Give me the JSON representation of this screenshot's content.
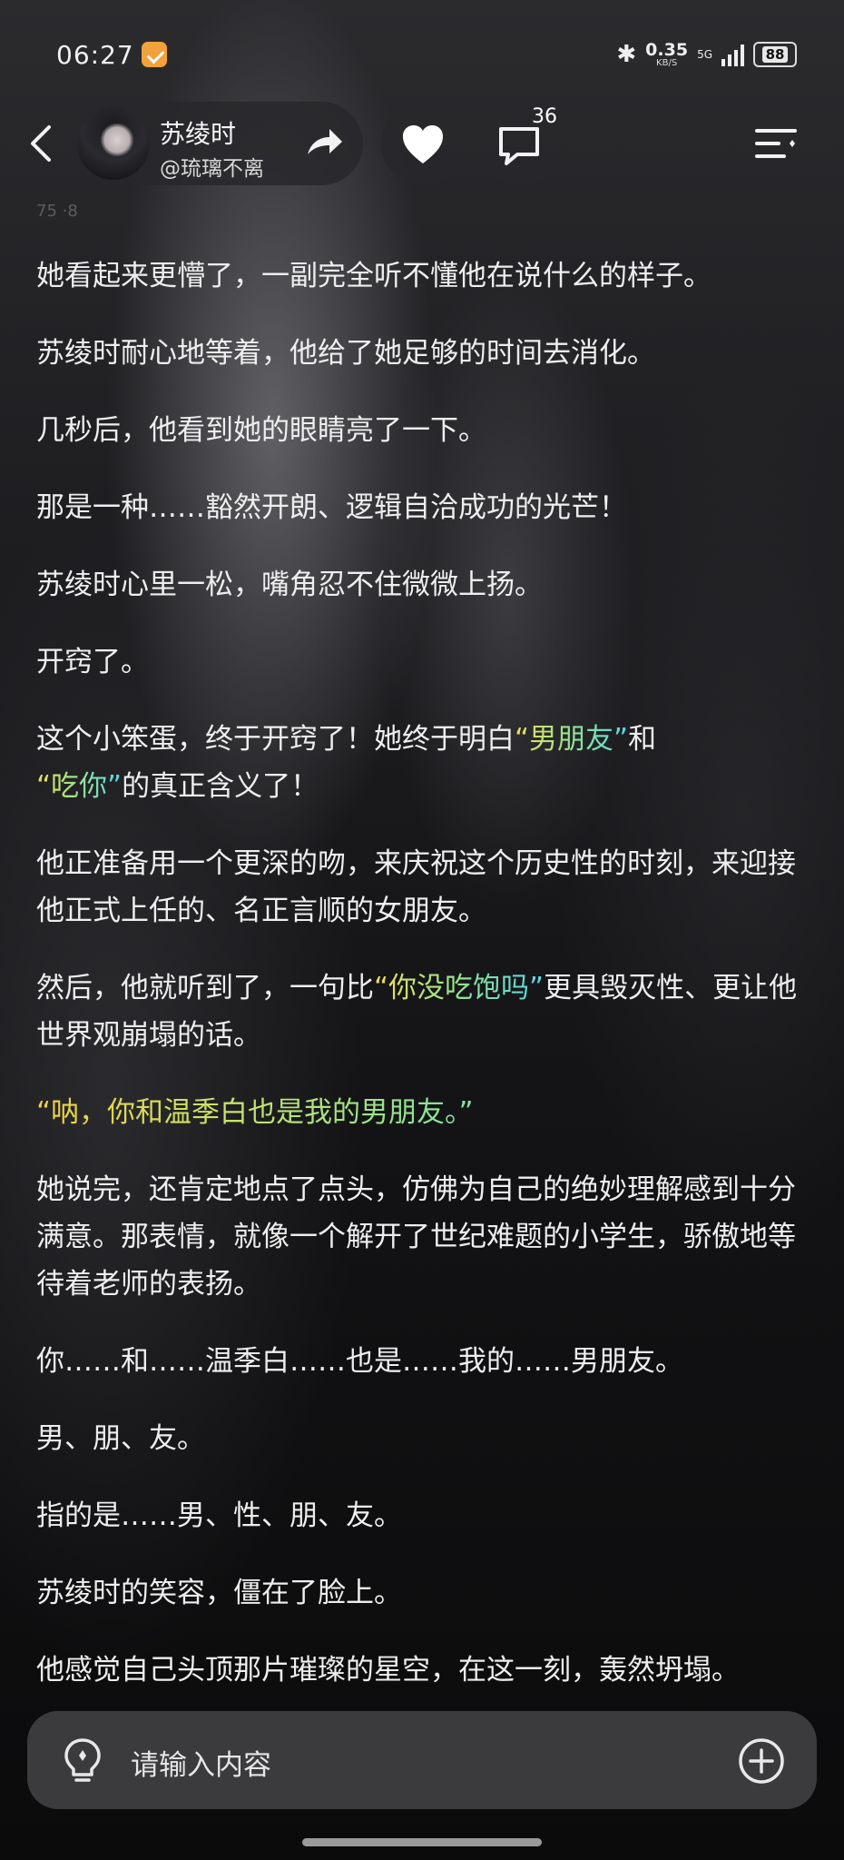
{
  "status_bar": {
    "time": "06:27",
    "net_speed": "0.35",
    "net_speed_unit": "KB/S",
    "network": "5G",
    "battery": "88"
  },
  "header": {
    "author_name": "苏绫时",
    "author_handle": "@琉璃不离",
    "comment_count": "36",
    "faint_text": "75 ·8"
  },
  "paragraphs": [
    "她看起来更懵了，一副完全听不懂他在说什么的样子。",
    "苏绫时耐心地等着，他给了她足够的时间去消化。",
    "几秒后，他看到她的眼睛亮了一下。",
    "那是一种……豁然开朗、逻辑自洽成功的光芒！",
    "苏绫时心里一松，嘴角忍不住微微上扬。",
    "开窍了。"
  ],
  "p7": {
    "a": "这个小笨蛋，终于开窍了！她终于明白",
    "b": "“男朋友”",
    "c": "和",
    "d": "“吃你”",
    "e": "的真正含义了！"
  },
  "p8": "他正准备用一个更深的吻，来庆祝这个历史性的时刻，来迎接他正式上任的、名正言顺的女朋友。",
  "p9": {
    "a": "然后，他就听到了，一句比",
    "b": "“你没吃饱吗”",
    "c": "更具毁灭性、更让他世界观崩塌的话。"
  },
  "p10": "“呐，你和温季白也是我的男朋友。”",
  "p11": "她说完，还肯定地点了点头，仿佛为自己的绝妙理解感到十分满意。那表情，就像一个解开了世纪难题的小学生，骄傲地等待着老师的表扬。",
  "p12": "你……和……温季白……也是……我的……男朋友。",
  "p13": "男、朋、友。",
  "p14": "指的是……男、性、朋、友。",
  "p15": "苏绫时的笑容，僵在了脸上。",
  "p16": "他感觉自己头顶那片璀璨的星空，在这一刻，轰然坍塌。",
  "input": {
    "placeholder": "请输入内容"
  }
}
